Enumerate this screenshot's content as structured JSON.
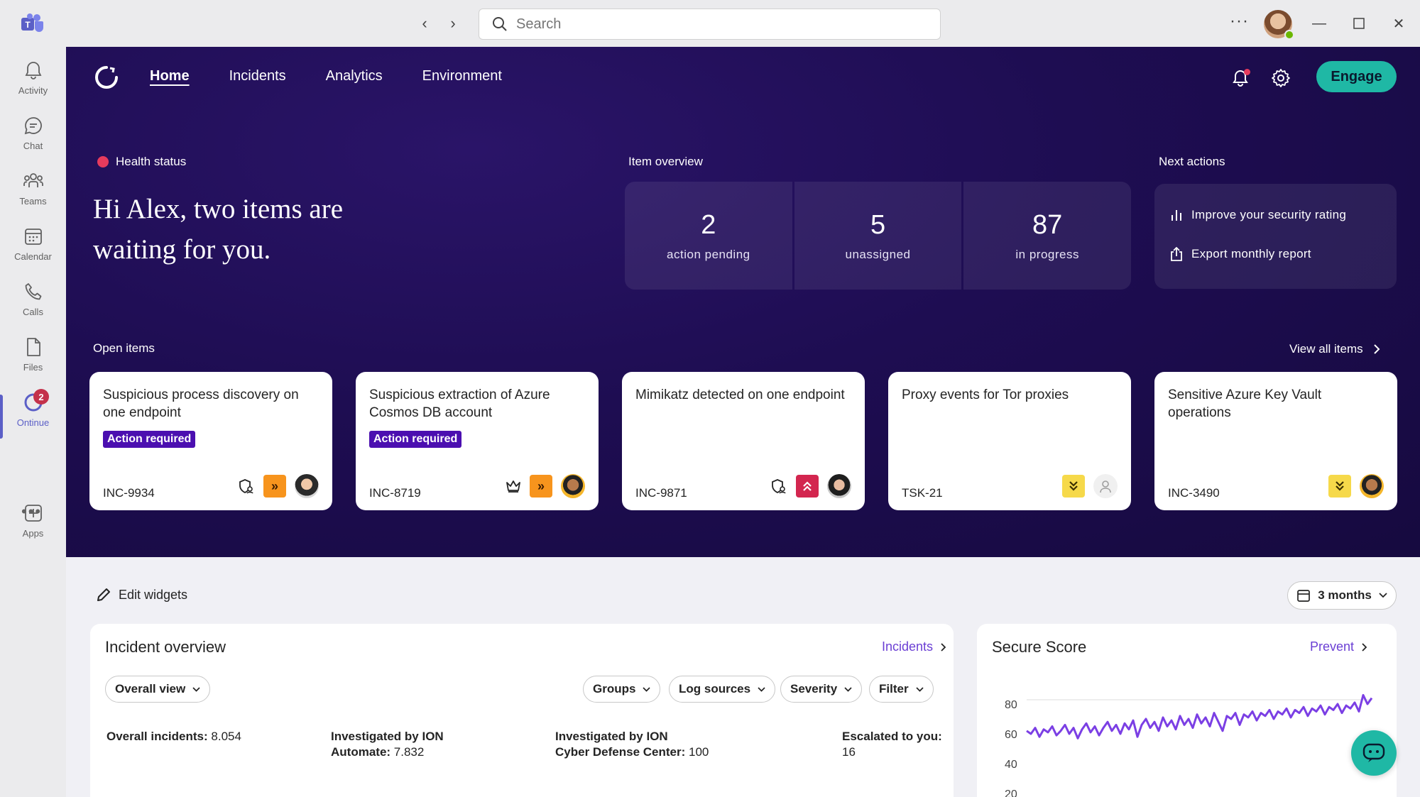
{
  "titlebar": {
    "search_placeholder": "Search"
  },
  "rail": {
    "items": [
      {
        "label": "Activity",
        "icon": "bell-icon"
      },
      {
        "label": "Chat",
        "icon": "chat-icon"
      },
      {
        "label": "Teams",
        "icon": "teams-icon"
      },
      {
        "label": "Calendar",
        "icon": "calendar-icon"
      },
      {
        "label": "Calls",
        "icon": "phone-icon"
      },
      {
        "label": "Files",
        "icon": "file-icon"
      },
      {
        "label": "Ontinue",
        "icon": "ontinue-icon",
        "badge": "2"
      },
      {
        "label": "Apps",
        "icon": "add-app-icon"
      }
    ]
  },
  "nav": {
    "items": [
      "Home",
      "Incidents",
      "Analytics",
      "Environment"
    ],
    "active": "Home",
    "engage": "Engage"
  },
  "hero": {
    "health_label": "Health status",
    "greeting": "Hi Alex, two items are waiting for you.",
    "overview_label": "Item overview",
    "overview": [
      {
        "value": "2",
        "label": "action pending"
      },
      {
        "value": "5",
        "label": "unassigned"
      },
      {
        "value": "87",
        "label": "in progress"
      }
    ],
    "next_label": "Next actions",
    "next_actions": [
      "Improve your security rating",
      "Export monthly report"
    ],
    "open_items_label": "Open items",
    "view_all": "View all items"
  },
  "cards": [
    {
      "title": "Suspicious process discovery on one endpoint",
      "badge": "Action required",
      "id": "INC-9934",
      "priority": "high"
    },
    {
      "title": "Suspicious extraction of Azure Cosmos DB account",
      "badge": "Action required",
      "id": "INC-8719",
      "priority": "high"
    },
    {
      "title": "Mimikatz detected on one endpoint",
      "badge": "",
      "id": "INC-9871",
      "priority": "critical"
    },
    {
      "title": "Proxy events for Tor proxies",
      "badge": "",
      "id": "TSK-21",
      "priority": "low"
    },
    {
      "title": "Sensitive Azure Key Vault operations",
      "badge": "",
      "id": "INC-3490",
      "priority": "low"
    }
  ],
  "lower": {
    "edit_widgets": "Edit widgets",
    "range": "3 months"
  },
  "incident_overview": {
    "title": "Incident overview",
    "link": "Incidents",
    "view_select": "Overall view",
    "filters": [
      "Groups",
      "Log sources",
      "Severity",
      "Filter"
    ],
    "stats": [
      {
        "label": "Overall incidents:",
        "value": "8.054"
      },
      {
        "label_line1": "Investigated by ION",
        "label": "Automate:",
        "value": "7.832"
      },
      {
        "label_line1": "Investigated by ION",
        "label": "Cyber Defense Center:",
        "value": "100"
      },
      {
        "label": "Escalated to you:",
        "value": "16"
      }
    ]
  },
  "secure_score": {
    "title": "Secure Score",
    "link": "Prevent"
  },
  "chart_data": {
    "type": "line",
    "title": "",
    "y_ticks": [
      80,
      60,
      40,
      20
    ],
    "ylim": [
      20,
      90
    ],
    "series": [
      {
        "color": "#7b3fe4",
        "values": [
          62,
          60,
          64,
          58,
          63,
          61,
          65,
          59,
          62,
          66,
          60,
          64,
          57,
          63,
          67,
          61,
          65,
          59,
          64,
          68,
          62,
          66,
          60,
          67,
          63,
          69,
          58,
          66,
          70,
          64,
          68,
          62,
          71,
          65,
          69,
          63,
          72,
          66,
          70,
          64,
          73,
          67,
          71,
          65,
          74,
          68,
          62,
          72,
          70,
          74,
          66,
          73,
          71,
          75,
          69,
          74,
          72,
          76,
          70,
          75,
          73,
          77,
          71,
          76,
          74,
          78,
          72,
          77,
          75,
          79,
          73,
          78,
          76,
          80,
          74,
          79,
          77,
          81,
          75,
          86,
          80,
          84
        ]
      }
    ]
  },
  "colors": {
    "hero_bg": "#1e0d52",
    "accent_teal": "#1fb8a5",
    "badge_purple": "#4b0fb0",
    "link_purple": "#6b3fd4",
    "health_red": "#e63b5d"
  }
}
